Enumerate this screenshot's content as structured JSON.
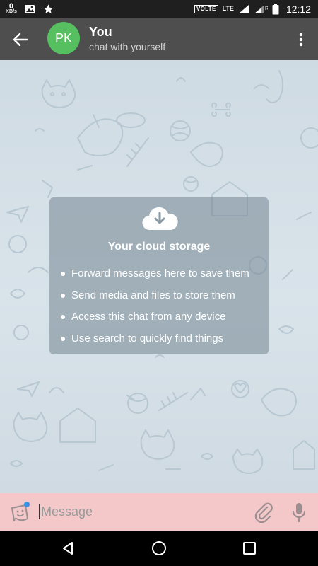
{
  "status_bar": {
    "speed_value": "0",
    "speed_unit": "KB/s",
    "volte_label": "VOLTE",
    "network_label": "LTE",
    "roaming_label": "R",
    "time": "12:12",
    "icons": [
      "image-icon",
      "star-icon",
      "signal-icon",
      "battery-icon"
    ]
  },
  "header": {
    "avatar_initials": "PK",
    "avatar_color": "#56c061",
    "title": "You",
    "subtitle": "chat with yourself",
    "background_color": "#4e4e4e"
  },
  "cloud_card": {
    "title": "Your cloud storage",
    "items": [
      "Forward messages here to save them",
      "Send media and files to store them",
      "Access this chat from any device",
      "Use search to quickly find things"
    ]
  },
  "composer": {
    "placeholder": "Message",
    "value": "",
    "background_color": "#f4c7c9"
  },
  "nav_bar": {
    "icons": [
      "back-triangle-icon",
      "home-circle-icon",
      "recents-square-icon"
    ]
  }
}
